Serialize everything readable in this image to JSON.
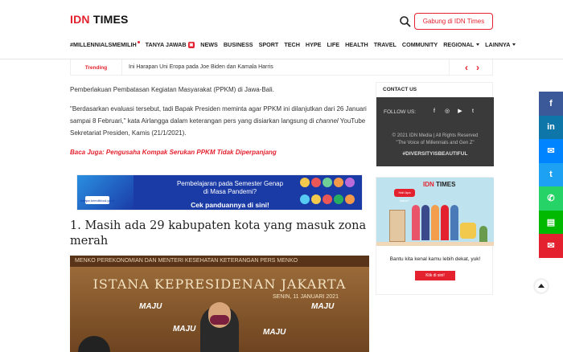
{
  "header": {
    "logo_idn": "IDN",
    "logo_times": "TIMES",
    "join_label": "Gabung di IDN Times",
    "search_icon": "search-icon"
  },
  "nav": {
    "items": [
      "#MILLENNIALSMEMILIH",
      "TANYA JAWAB",
      "NEWS",
      "BUSINESS",
      "SPORT",
      "TECH",
      "HYPE",
      "LIFE",
      "HEALTH",
      "TRAVEL",
      "COMMUNITY",
      "REGIONAL",
      "LAINNYA"
    ]
  },
  "trending": {
    "label": "Trending",
    "text": "Ini Harapan Uni Eropa pada Joe Biden dan Kamala Harris",
    "prev": "‹",
    "next": "›"
  },
  "article": {
    "p1": "Pemberlakuan Pembatasan Kegiatan Masyarakat (PPKM) di Jawa-Bali.",
    "p2_a": "\"Berdasarkan evaluasi tersebut, tadi Bapak Presiden meminta agar PPKM ini dilanjutkan dari 26 Januari sampai 8 Februari,\" kata Airlangga dalam keterangan pers yang disiarkan langsung di ",
    "p2_italic": "channel",
    "p2_b": " YouTube Sekretariat Presiden, Kamis (21/1/2021).",
    "read_also": "Baca Juga: Pengusaha Kompak Serukan PPKM Tidak Diperpanjang",
    "heading": "1. Masih ada 29 kabupaten kota yang masuk zona merah"
  },
  "banner": {
    "line1": "Pembelajaran pada Semester Genap",
    "line2": "di Masa Pandemi?",
    "line3": "Cek panduannya di sini!",
    "logo_text": "belajar.kemdikbud.go.id"
  },
  "photo": {
    "strip": "MENKO PEREKONOMIAN DAN MENTERI KESEHATAN   KETERANGAN PERS MENKO",
    "wall_title": "ISTANA KEPRESIDENAN JAKARTA",
    "wall_date": "SENIN, 11 JANUARI 2021",
    "maju": "MAJU"
  },
  "sidebar": {
    "contact_title": "CONTACT US",
    "follow_us": "FOLLOW US:",
    "copyright_1": "© 2021 IDN Media | All Rights Reserved",
    "copyright_2": "\"The Voice of Millennials and Gen Z\"",
    "hashtag": "#DIVERSITYISBEAUTIFUL",
    "ad_logo_idn": "IDN",
    "ad_logo_times": "TIMES",
    "ad_bubble": "Hai! Apa kabar?",
    "ad_text": "Bantu kita kenal kamu lebih dekat, yuk!",
    "ad_button": "Klik di sini!"
  },
  "share": {
    "icons": [
      "facebook-icon",
      "linkedin-icon",
      "messenger-icon",
      "twitter-icon",
      "whatsapp-icon",
      "line-icon",
      "email-icon"
    ],
    "colors": [
      "#3b5998",
      "#0e76a8",
      "#0084ff",
      "#1da1f2",
      "#25d366",
      "#00b900",
      "#e4222f"
    ]
  }
}
